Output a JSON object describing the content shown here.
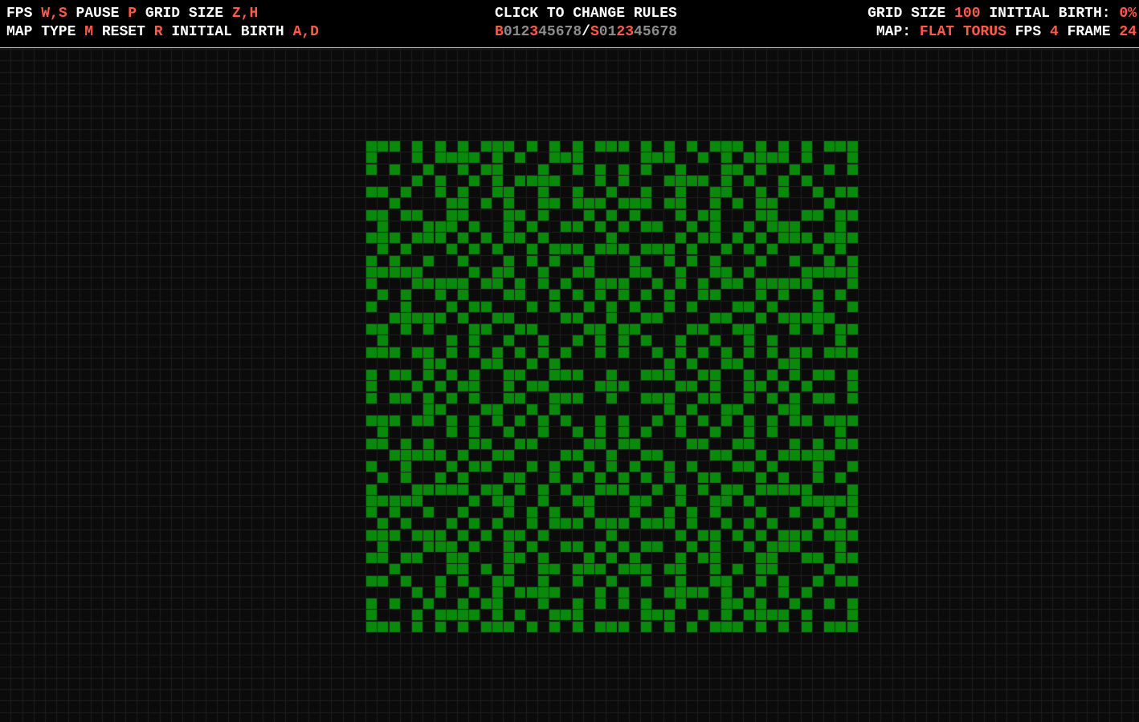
{
  "hud": {
    "controls": {
      "fps_label": "FPS",
      "fps_keys": "W,S",
      "pause_label": "PAUSE",
      "pause_key": "P",
      "grid_size_label": "GRID SIZE",
      "grid_size_keys": "Z,H",
      "map_type_label": "MAP TYPE",
      "map_type_key": "M",
      "reset_label": "RESET",
      "reset_key": "R",
      "initial_birth_label": "INITIAL BIRTH",
      "initial_birth_keys": "A,D"
    },
    "rules": {
      "title": "CLICK TO CHANGE RULES",
      "birth_prefix": "B",
      "survive_prefix": "S",
      "separator": "/",
      "digits": [
        "0",
        "1",
        "2",
        "3",
        "4",
        "5",
        "6",
        "7",
        "8"
      ],
      "birth_active": [
        3
      ],
      "survive_active": [
        2,
        3
      ]
    },
    "status": {
      "grid_size_label": "GRID SIZE",
      "grid_size_value": "100",
      "initial_birth_label": "INITIAL BIRTH:",
      "initial_birth_value": "0%",
      "map_label": "MAP:",
      "map_value": "FLAT TORUS",
      "fps_label": "FPS",
      "fps_value": "4",
      "frame_label": "FRAME",
      "frame_value": "24"
    }
  },
  "colors": {
    "background": "#0b0b0b",
    "grid_line": "#1e1e1e",
    "cell_alive": "#0a8a0a",
    "hud_bg": "#000000",
    "hud_text": "#ffffff",
    "hud_key": "#ff5a4a",
    "rule_inactive": "#8c8c8c"
  },
  "grid": {
    "columns": 100,
    "rows": 100,
    "pattern_rows": [
      "#.#.#.#.#.#.#.#.#.#.#.#.#.#.#.#.#.#.#.#.#",
      "##...##...##...##...##...##...##...##...",
      "#.#.#.#.#.#.#.#.#.#.#.#.#.#.#.#.#.#.#.#.#"
    ]
  }
}
